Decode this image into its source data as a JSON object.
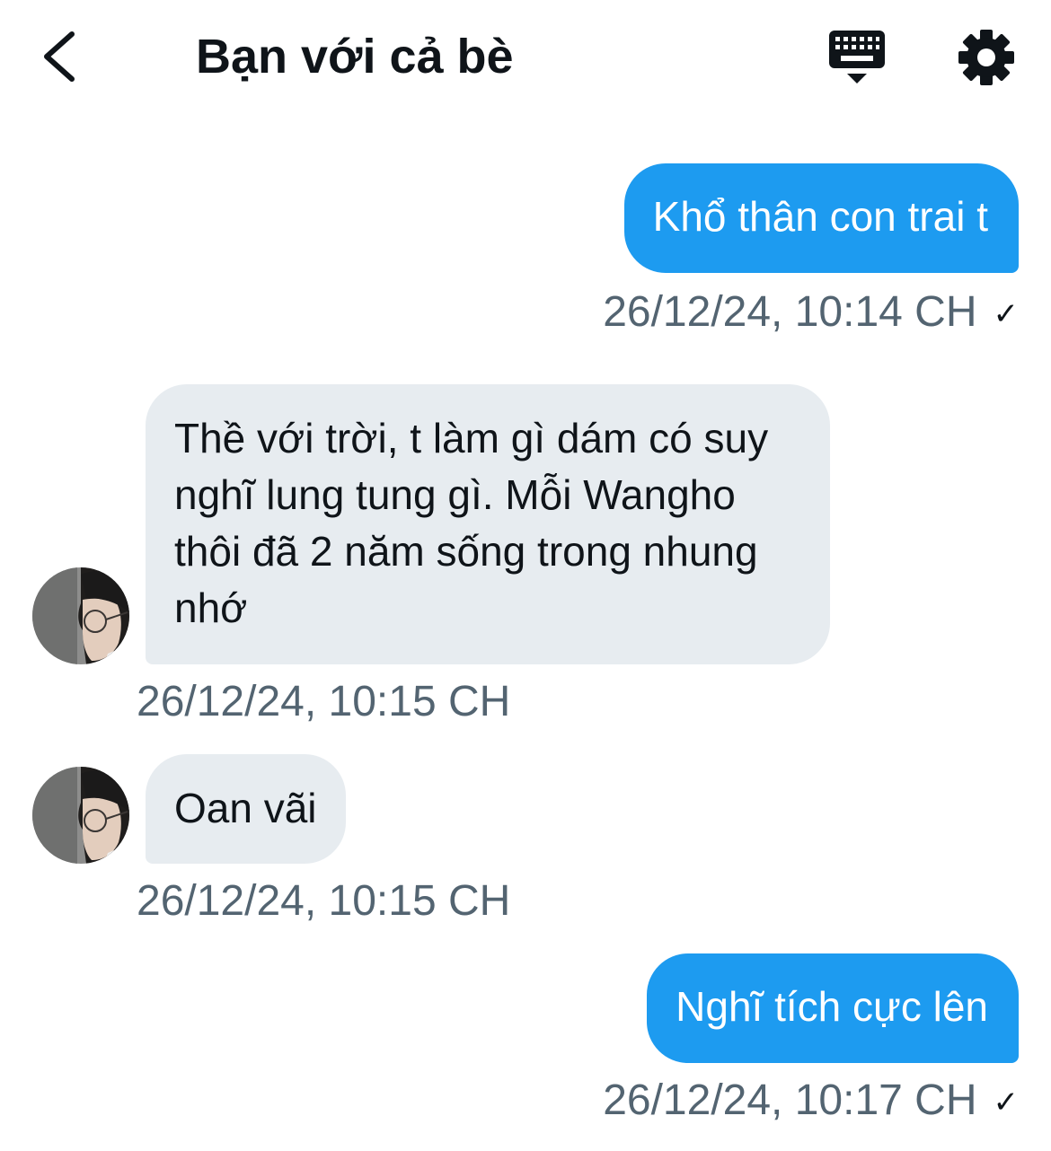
{
  "header": {
    "title": "Bạn với cả bè",
    "back_icon": "chevron-left-icon",
    "keyboard_icon": "keyboard-icon",
    "settings_icon": "gear-icon"
  },
  "colors": {
    "outgoing_bubble": "#1d9bf0",
    "incoming_bubble": "#e7ecf0",
    "timestamp": "#536471"
  },
  "messages": [
    {
      "direction": "outgoing",
      "text": "Khổ thân con trai t",
      "time": "26/12/24, 10:14 CH",
      "status": "✓"
    },
    {
      "direction": "incoming",
      "text": "Thề với trời, t làm gì dám có suy nghĩ lung tung gì. Mỗi Wangho thôi đã 2 năm sống trong nhung nhớ",
      "time": "26/12/24, 10:15 CH"
    },
    {
      "direction": "incoming",
      "text": "Oan vãi",
      "time": "26/12/24, 10:15 CH"
    },
    {
      "direction": "outgoing",
      "text": "Nghĩ tích cực lên",
      "time": "26/12/24, 10:17 CH",
      "status": "✓"
    }
  ]
}
